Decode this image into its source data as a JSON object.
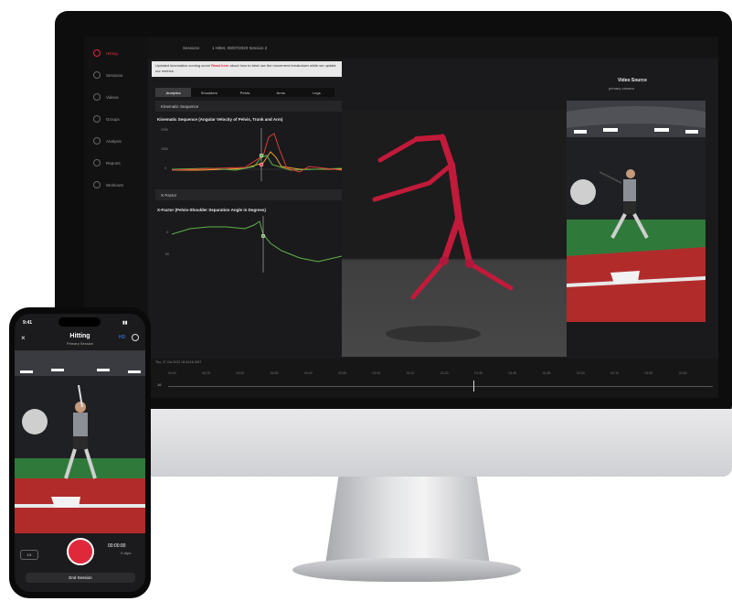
{
  "desktop": {
    "sidebar": {
      "items": [
        {
          "label": "Hitting",
          "icon": "home-icon"
        },
        {
          "label": "Sessions",
          "icon": "sessions-icon"
        },
        {
          "label": "Videos",
          "icon": "video-icon"
        },
        {
          "label": "Groups",
          "icon": "groups-icon"
        },
        {
          "label": "Analysis",
          "icon": "analysis-icon"
        },
        {
          "label": "Reports",
          "icon": "reports-icon"
        },
        {
          "label": "Workouts",
          "icon": "workouts-icon"
        }
      ]
    },
    "topbar": {
      "breadcrumb": "Sessions",
      "session_title": "1 Hitter, 09/07/2023 Session 2"
    },
    "notice": {
      "text_before": "Updated kinematics coming soon!",
      "link": "Read here",
      "text_after": "about how to best use the movement breakdown while we update our metrics."
    },
    "tabs": [
      "Analytics",
      "Shoulders",
      "Pelvis",
      "Arms",
      "Legs"
    ],
    "active_tab": "Analytics",
    "kinematic_section": {
      "header": "Kinematic Sequence",
      "chart_title": "Kinematic Sequence (Angular Velocity of Pelvis, Trunk and Arm)",
      "y_ticks": [
        "2000",
        "1000",
        "0"
      ]
    },
    "xfactor_section": {
      "header": "X-Factor",
      "chart_title": "X-Factor (Pelvis-Shoulder Separation Angle in Degrees)",
      "y_ticks": [
        "0",
        "-50"
      ]
    },
    "video_source": {
      "title": "Video Source",
      "subtitle": "primary camera"
    },
    "timeline": {
      "date": "Thu, 27 Oct 2022 16:34:16 GMT",
      "start_label": "16",
      "ticks": [
        "00:00",
        "00:10",
        "00:20",
        "00:30",
        "00:40",
        "00:50",
        "01:00",
        "01:10",
        "01:20",
        "01:30",
        "01:40",
        "01:50",
        "02:00",
        "02:10",
        "02:20",
        "02:30"
      ]
    },
    "colors": {
      "accent": "#e0283b",
      "series_pelvis": "#e23a3a",
      "series_trunk": "#f0a030",
      "series_arm": "#5fb24a"
    }
  },
  "phone": {
    "status": {
      "time": "9:41"
    },
    "header": {
      "title": "Hitting",
      "subtitle": "Primary Session"
    },
    "controls": {
      "camera_label": "1X",
      "timer": "00:00:00",
      "clips": "0 clips"
    },
    "end_button": "End Session"
  }
}
